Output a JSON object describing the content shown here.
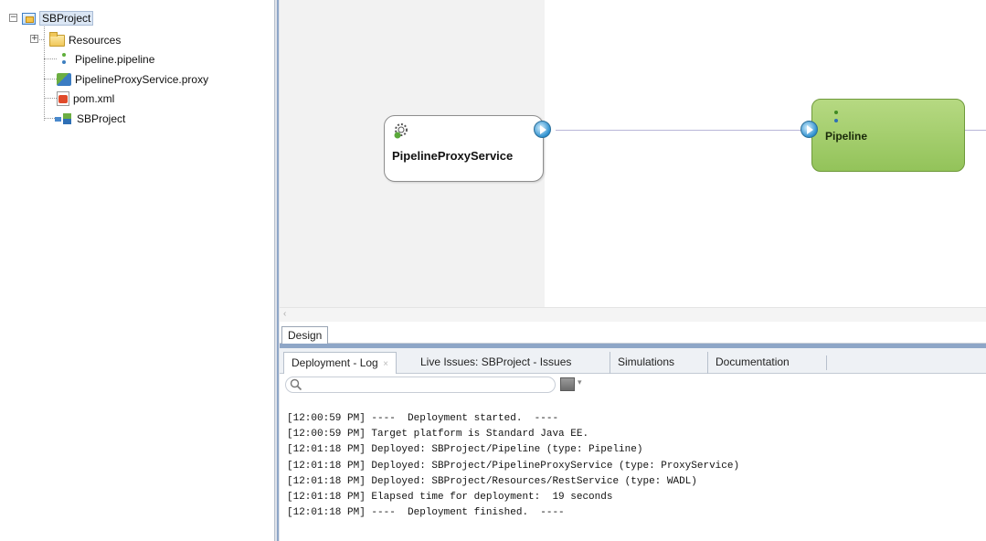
{
  "tree": {
    "root": "SBProject",
    "items": [
      {
        "label": "Resources",
        "icon": "folder-icon",
        "expander": "+"
      },
      {
        "label": "Pipeline.pipeline",
        "icon": "pipeline-file-icon"
      },
      {
        "label": "PipelineProxyService.proxy",
        "icon": "proxy-service-file-icon"
      },
      {
        "label": "pom.xml",
        "icon": "maven-pom-icon"
      },
      {
        "label": "SBProject",
        "icon": "service-bus-project-icon"
      }
    ],
    "root_expander": "−"
  },
  "canvas": {
    "proxy_node": {
      "label": "PipelineProxyService",
      "icon": "gear-icon"
    },
    "pipeline_node": {
      "label": "Pipeline",
      "icon": "pipeline-icon"
    },
    "scroll_arrow": "‹",
    "colors": {
      "pipeline_fill": "#a4cd6e",
      "lane": "#f2f2f2",
      "connector": "#b9b6d8"
    }
  },
  "editor_tab": {
    "label": "Design"
  },
  "log": {
    "tabs": [
      {
        "label": "Deployment - Log",
        "active": true,
        "close": "×"
      },
      {
        "label": "Live Issues: SBProject - Issues"
      },
      {
        "label": "Simulations"
      },
      {
        "label": "Documentation"
      }
    ],
    "search_placeholder": "",
    "filter_dropdown": "▾",
    "lines": [
      "[12:00:59 PM] ----  Deployment started.  ----",
      "[12:00:59 PM] Target platform is Standard Java EE.",
      "[12:01:18 PM] Deployed: SBProject/Pipeline (type: Pipeline)",
      "[12:01:18 PM] Deployed: SBProject/PipelineProxyService (type: ProxyService)",
      "[12:01:18 PM] Deployed: SBProject/Resources/RestService (type: WADL)",
      "[12:01:18 PM] Elapsed time for deployment:  19 seconds",
      "[12:01:18 PM] ----  Deployment finished.  ----"
    ]
  }
}
